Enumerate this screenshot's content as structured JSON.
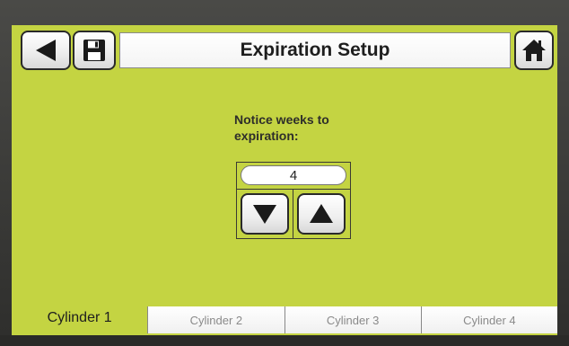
{
  "header": {
    "title": "Expiration Setup",
    "back_icon": "back-arrow-icon",
    "save_icon": "floppy-disk-icon",
    "home_icon": "home-icon"
  },
  "setting": {
    "label": "Notice weeks to expiration:",
    "value": "4",
    "decrement_icon": "down-triangle-icon",
    "increment_icon": "up-triangle-icon"
  },
  "tabs": [
    {
      "label": "Cylinder 1",
      "active": true
    },
    {
      "label": "Cylinder 2",
      "active": false
    },
    {
      "label": "Cylinder 3",
      "active": false
    },
    {
      "label": "Cylinder 4",
      "active": false
    }
  ],
  "colors": {
    "screen_background": "#c4d442",
    "button_face": "#ffffff",
    "active_tab_text": "#1e1e1e",
    "inactive_tab_text": "#8a8a8a"
  }
}
